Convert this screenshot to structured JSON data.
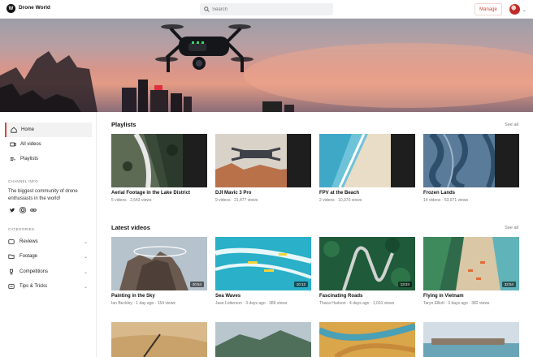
{
  "header": {
    "logo_glyph": "W",
    "brand": "Drone World",
    "search_placeholder": "Search",
    "manage_label": "Manage"
  },
  "sidebar": {
    "nav": [
      {
        "label": "Home",
        "icon": "home-icon",
        "active": true
      },
      {
        "label": "All videos",
        "icon": "video-icon",
        "active": false
      },
      {
        "label": "Playlists",
        "icon": "playlist-icon",
        "active": false
      }
    ],
    "channel_info_title": "CHANNEL INFO",
    "channel_desc": "The biggest community of drone enthusiasts in the world!",
    "social_icons": [
      "twitter-icon",
      "instagram-icon",
      "link-icon"
    ],
    "categories_title": "CATEGORIES",
    "categories": [
      {
        "label": "Reviews",
        "icon": "star-icon"
      },
      {
        "label": "Footage",
        "icon": "folder-icon"
      },
      {
        "label": "Competitions",
        "icon": "trophy-icon"
      },
      {
        "label": "Tips & Tricks",
        "icon": "bulb-icon"
      }
    ]
  },
  "playlists": {
    "heading": "Playlists",
    "see_all": "See all",
    "items": [
      {
        "title": "Aerial Footage in the Lake District",
        "meta": "5 videos  ·  2,543 views"
      },
      {
        "title": "DJI Mavic 3 Pro",
        "meta": "9 videos  ·  21,477 views"
      },
      {
        "title": "FPV at the Beach",
        "meta": "2 videos  ·  10,370 views"
      },
      {
        "title": "Frozen Lands",
        "meta": "14 videos  ·  53,971 views"
      }
    ]
  },
  "latest": {
    "heading": "Latest videos",
    "see_all": "See all",
    "items": [
      {
        "title": "Painting in the Sky",
        "meta": "Ian Beckley  ·  1 day ago  ·  154 views",
        "duration": "20:54"
      },
      {
        "title": "Sea Waves",
        "meta": "Jase Lotterson  ·  3 days ago  ·  386 views",
        "duration": "10:12"
      },
      {
        "title": "Fascinating Roads",
        "meta": "Thaca Hudson  ·  4 days ago  ·  1,031 views",
        "duration": "13:24"
      },
      {
        "title": "Flying in Vietnam",
        "meta": "Taryn Elliott  ·  3 days ago  ·  382 views",
        "duration": "32:54"
      }
    ]
  },
  "colors": {
    "accent": "#d4483c"
  }
}
